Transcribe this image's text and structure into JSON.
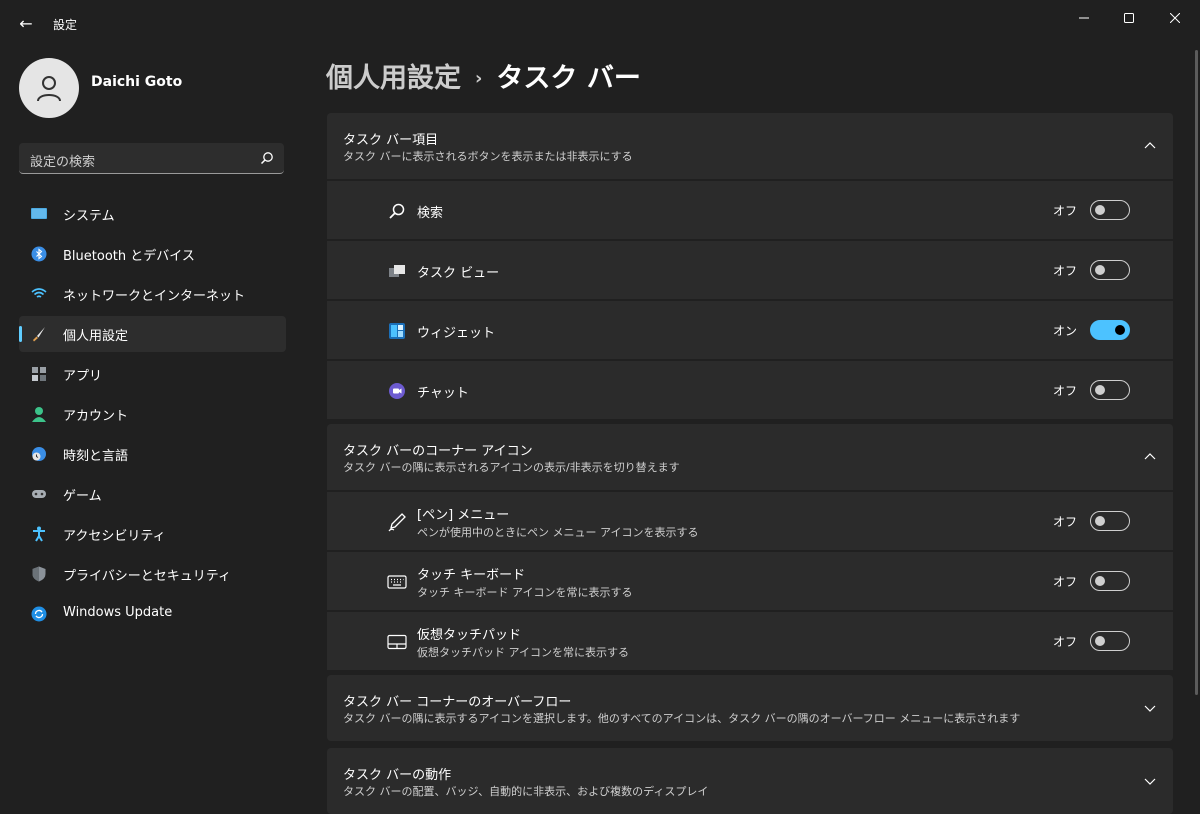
{
  "window": {
    "title": "設定"
  },
  "profile": {
    "name": "Daichi Goto"
  },
  "search": {
    "placeholder": "設定の検索"
  },
  "sidebar": {
    "items": [
      {
        "label": "システム",
        "icon": "system-icon"
      },
      {
        "label": "Bluetooth とデバイス",
        "icon": "bluetooth-icon"
      },
      {
        "label": "ネットワークとインターネット",
        "icon": "network-icon"
      },
      {
        "label": "個人用設定",
        "icon": "personalization-icon",
        "active": true
      },
      {
        "label": "アプリ",
        "icon": "apps-icon"
      },
      {
        "label": "アカウント",
        "icon": "account-icon"
      },
      {
        "label": "時刻と言語",
        "icon": "time-language-icon"
      },
      {
        "label": "ゲーム",
        "icon": "gaming-icon"
      },
      {
        "label": "アクセシビリティ",
        "icon": "accessibility-icon"
      },
      {
        "label": "プライバシーとセキュリティ",
        "icon": "privacy-shield-icon"
      },
      {
        "label": "Windows Update",
        "icon": "windows-update-icon"
      }
    ]
  },
  "breadcrumb": {
    "parent": "個人用設定",
    "separator": "›",
    "current": "タスク バー"
  },
  "sections": [
    {
      "title": "タスク バー項目",
      "subtitle": "タスク バーに表示されるボタンを表示または非表示にする",
      "expanded": true,
      "rows": [
        {
          "label": "検索",
          "state": "オフ",
          "on": false,
          "icon": "search-icon"
        },
        {
          "label": "タスク ビュー",
          "state": "オフ",
          "on": false,
          "icon": "task-view-icon"
        },
        {
          "label": "ウィジェット",
          "state": "オン",
          "on": true,
          "icon": "widgets-icon"
        },
        {
          "label": "チャット",
          "state": "オフ",
          "on": false,
          "icon": "chat-icon"
        }
      ]
    },
    {
      "title": "タスク バーのコーナー アイコン",
      "subtitle": "タスク バーの隅に表示されるアイコンの表示/非表示を切り替えます",
      "expanded": true,
      "rows": [
        {
          "label": "[ペン] メニュー",
          "sub": "ペンが使用中のときにペン メニュー アイコンを表示する",
          "state": "オフ",
          "on": false,
          "icon": "pen-icon"
        },
        {
          "label": "タッチ キーボード",
          "sub": "タッチ キーボード アイコンを常に表示する",
          "state": "オフ",
          "on": false,
          "icon": "keyboard-icon"
        },
        {
          "label": "仮想タッチパッド",
          "sub": "仮想タッチパッド アイコンを常に表示する",
          "state": "オフ",
          "on": false,
          "icon": "touchpad-icon"
        }
      ]
    },
    {
      "title": "タスク バー コーナーのオーバーフロー",
      "subtitle": "タスク バーの隅に表示するアイコンを選択します。他のすべてのアイコンは、タスク バーの隅のオーバーフロー メニューに表示されます",
      "expanded": false
    },
    {
      "title": "タスク バーの動作",
      "subtitle": "タスク バーの配置、バッジ、自動的に非表示、および複数のディスプレイ",
      "expanded": false
    }
  ],
  "colors": {
    "accent": "#4cc2ff",
    "background": "#202020",
    "card": "#2b2b2b"
  }
}
